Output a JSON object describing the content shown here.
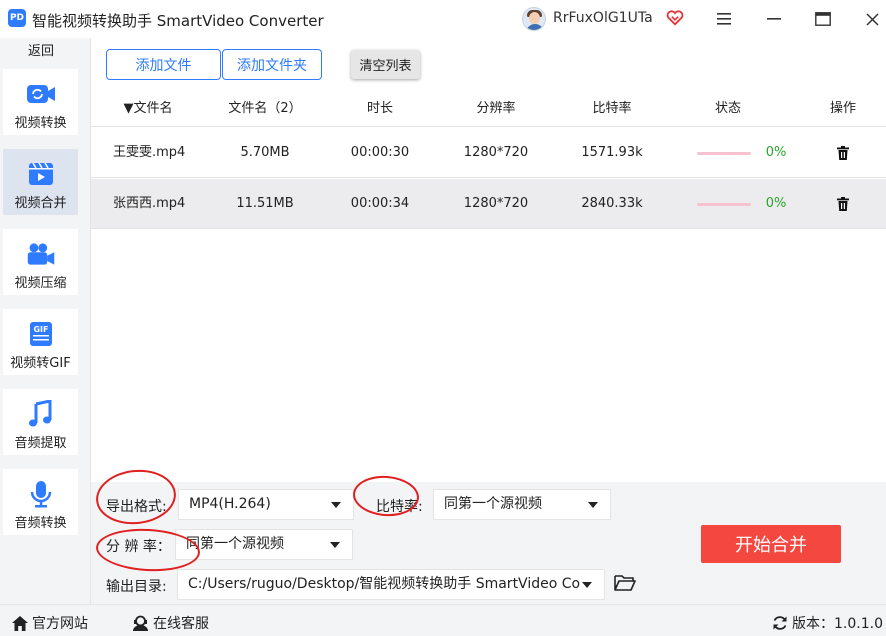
{
  "window": {
    "title": "智能视频转换助手 SmartVideo Converter",
    "logo_text": "PD",
    "username": "RrFuxOlG1UTa"
  },
  "sidebar": {
    "back_label": "返回",
    "items": [
      {
        "label": "视频转换",
        "icon": "video-convert-icon"
      },
      {
        "label": "视频合并",
        "icon": "video-merge-icon"
      },
      {
        "label": "视频压缩",
        "icon": "video-compress-icon"
      },
      {
        "label": "视频转GIF",
        "icon": "gif-icon"
      },
      {
        "label": "音频提取",
        "icon": "music-note-icon"
      },
      {
        "label": "音频转换",
        "icon": "microphone-icon"
      }
    ],
    "active_index": 1
  },
  "toolbar": {
    "add_file": "添加文件",
    "add_folder": "添加文件夹",
    "clear_list": "清空列表"
  },
  "table": {
    "headers": [
      "▼文件名",
      "文件名（2）",
      "时长",
      "分辨率",
      "比特率",
      "状态",
      "操作"
    ],
    "rows": [
      {
        "name": "王雯雯.mp4",
        "size": "5.70MB",
        "duration": "00:00:30",
        "resolution": "1280*720",
        "bitrate": "1571.93k",
        "progress": 0,
        "status": "0%"
      },
      {
        "name": "张西西.mp4",
        "size": "11.51MB",
        "duration": "00:00:34",
        "resolution": "1280*720",
        "bitrate": "2840.33k",
        "progress": 0,
        "status": "0%"
      }
    ]
  },
  "settings": {
    "format_label": "导出格式:",
    "format_value": "MP4(H.264)",
    "bitrate_label": "比特率:",
    "bitrate_value": "同第一个源视频",
    "resolution_label": "分 辨 率：",
    "resolution_value": "同第一个源视频",
    "output_label": "输出目录:",
    "output_path": "C:/Users/ruguo/Desktop/智能视频转换助手 SmartVideo Co",
    "start_button": "开始合并"
  },
  "statusbar": {
    "website": "官方网站",
    "support": "在线客服",
    "version": "版本：1.0.1.0"
  },
  "colors": {
    "accent": "#2f7bff",
    "start": "#f4473f",
    "progress": "#e84a75",
    "success": "#2aa52a",
    "annotation": "#e02020"
  }
}
